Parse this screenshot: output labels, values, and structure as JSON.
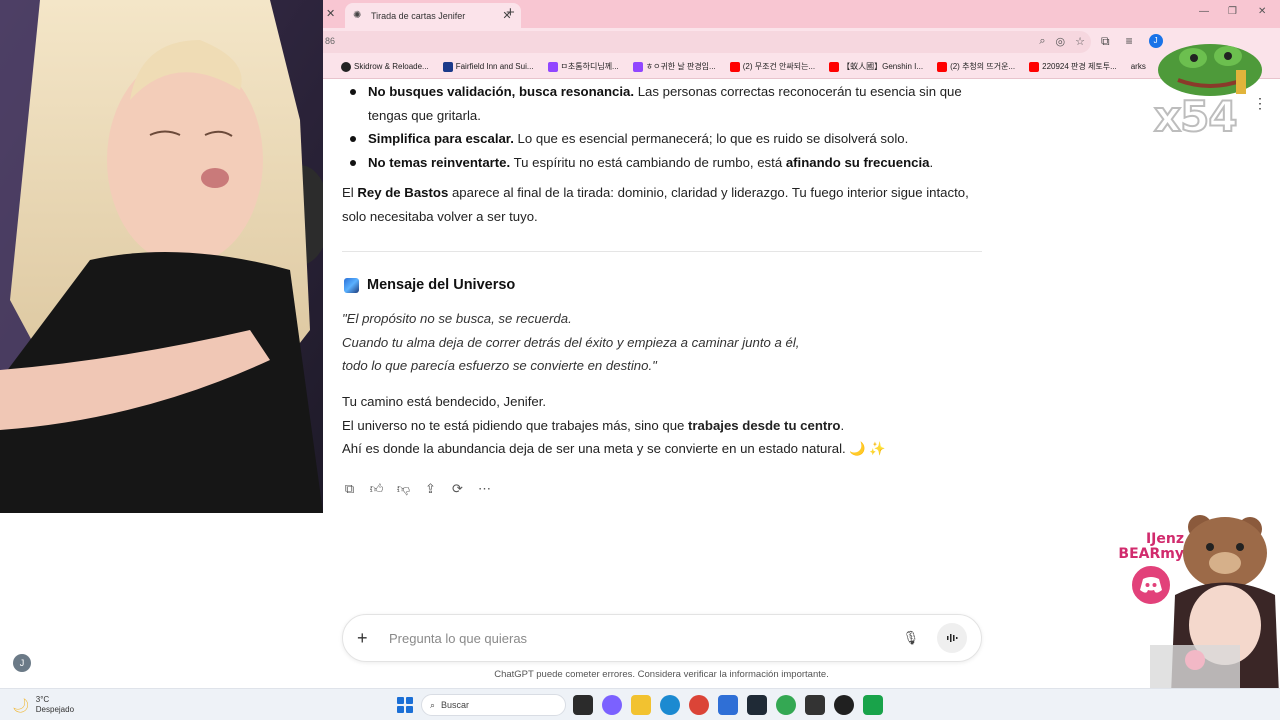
{
  "browser": {
    "tab_title": "Tirada de cartas Jenifer",
    "url_fragment": "86",
    "bookmarks": [
      {
        "label": "Skidrow & Reloade...",
        "color": "#222222"
      },
      {
        "label": "Fairfield Inn and Sui...",
        "color": "#1b3a8a"
      },
      {
        "label": "ㅁ초톰하디님께...",
        "color": "#9146ff"
      },
      {
        "label": "ㅎㅇ귀한 날 판경임...",
        "color": "#9146ff"
      },
      {
        "label": "(2) 무조건 안싸되는...",
        "color": "#ff0000"
      },
      {
        "label": "【蚁人國】Genshin I...",
        "color": "#ff0000"
      },
      {
        "label": "(2) 추청의 뜨거운...",
        "color": "#ff0000"
      },
      {
        "label": "220924 판경 제토투...",
        "color": "#ff0000"
      }
    ],
    "bookmarks_trailing": "arks",
    "profile_initial": "J"
  },
  "article": {
    "bullets": [
      {
        "bold": "No busques validación, busca resonancia.",
        "rest": " Las personas correctas reconocerán tu esencia sin que tengas que gritarla."
      },
      {
        "bold": "Simplifica para escalar.",
        "rest": " Lo que es esencial permanecerá; lo que es ruido se disolverá solo."
      },
      {
        "bold": "No temas reinventarte.",
        "rest": " Tu espíritu no está cambiando de rumbo, está ",
        "bold2": "afinando su frecuencia",
        "tail": "."
      }
    ],
    "paragraph": {
      "pre": "El ",
      "bold": "Rey de Bastos",
      "rest": " aparece al final de la tirada: dominio, claridad y liderazgo. Tu fuego interior sigue intacto, solo necesitaba volver a ser tuyo."
    },
    "section_title": "Mensaje del Universo",
    "quote_lines": [
      "\"El propósito no se busca, se recuerda.",
      "Cuando tu alma deja de correr detrás del éxito y empieza a caminar junto a él,",
      "todo lo que parecía esfuerzo se convierte en destino.\""
    ],
    "closing_line1": "Tu camino está bendecido, Jenifer.",
    "closing_line2_pre": "El universo no te está pidiendo que trabajes más, sino que ",
    "closing_line2_bold": "trabajes desde tu centro",
    "closing_line2_tail": ".",
    "closing_line3": "Ahí es donde la abundancia deja de ser una meta y se convierte en un estado natural. 🌙 ✨"
  },
  "composer": {
    "placeholder": "Pregunta lo que quieras",
    "disclaimer": "ChatGPT puede cometer errores. Considera verificar la información importante."
  },
  "user": {
    "initial": "J"
  },
  "overlay": {
    "counter": "x54",
    "brand_line1": "IJenz",
    "brand_line2": "BEARmy"
  },
  "taskbar": {
    "temp": "3°C",
    "weather": "Despejado",
    "search_label": "Buscar",
    "apps": [
      {
        "name": "task-view-icon",
        "color": "#2b2b2b"
      },
      {
        "name": "copilot-icon",
        "color": "#7b61ff"
      },
      {
        "name": "file-explorer-icon",
        "color": "#f2c230"
      },
      {
        "name": "edge-icon",
        "color": "#1c8ad1"
      },
      {
        "name": "chrome-icon",
        "color": "#db4437"
      },
      {
        "name": "store-icon",
        "color": "#2f6fd6"
      },
      {
        "name": "terminal-icon",
        "color": "#1f2a36"
      },
      {
        "name": "chrome-profile-icon",
        "color": "#34a853"
      },
      {
        "name": "app-icon",
        "color": "#333333"
      },
      {
        "name": "obs-icon",
        "color": "#202020"
      },
      {
        "name": "app-green-icon",
        "color": "#19a34a"
      }
    ]
  }
}
